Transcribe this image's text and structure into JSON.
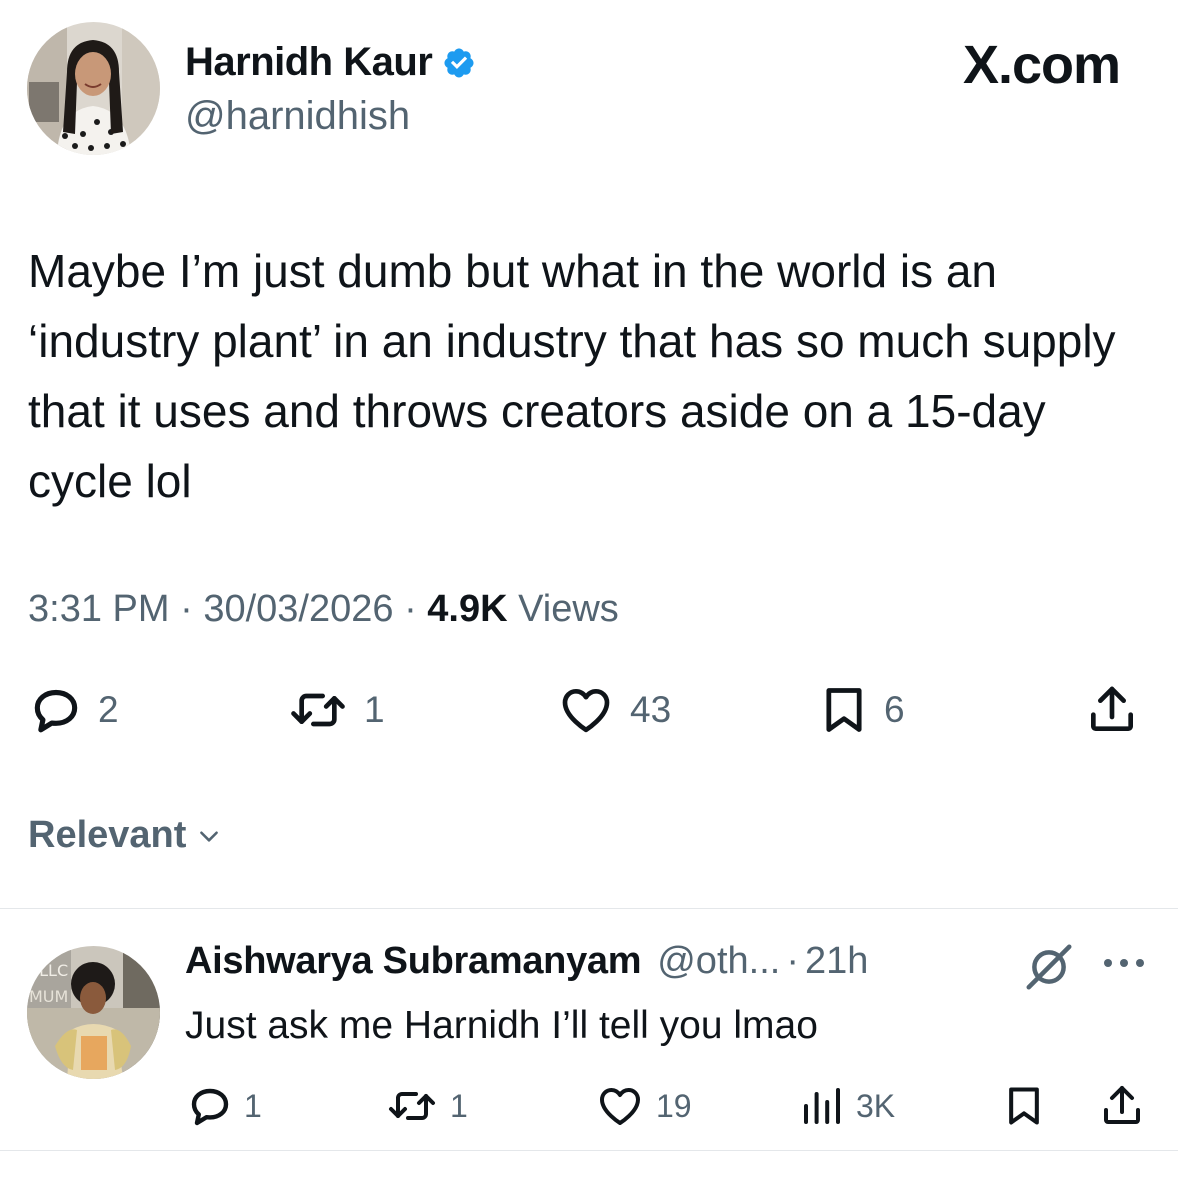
{
  "tweet": {
    "author_name": "Harnidh Kaur",
    "handle": "@harnidhish",
    "brand": "X.com",
    "text": "Maybe I’m just dumb but what in the world is an ‘industry plant’ in an industry that has so much supply that it uses and throws creators aside on a 15-day cycle lol",
    "time": "3:31 PM",
    "date": "30/03/2026",
    "separator": "·",
    "views_count": "4.9K",
    "views_label": "Views",
    "actions": {
      "replies": "2",
      "reposts": "1",
      "likes": "43",
      "bookmarks": "6"
    }
  },
  "sort": {
    "label": "Relevant"
  },
  "reply": {
    "author_name": "Aishwarya Subramanyam",
    "handle": "@oth...",
    "separator": "·",
    "time": "21h",
    "text": "Just ask me Harnidh I’ll tell you lmao",
    "actions": {
      "replies": "1",
      "reposts": "1",
      "likes": "19",
      "views": "3K"
    }
  },
  "icons": {
    "verified": "verified-badge-icon",
    "reply": "reply-icon",
    "repost": "repost-icon",
    "like": "heart-icon",
    "bookmark": "bookmark-icon",
    "share": "share-icon",
    "views": "views-icon",
    "grok": "grok-icon",
    "more": "more-icon",
    "chevron": "chevron-down-icon"
  },
  "colors": {
    "text": "#0f1419",
    "secondary": "#536471",
    "verified": "#1d9bf0",
    "divider": "#e4e7ea"
  }
}
